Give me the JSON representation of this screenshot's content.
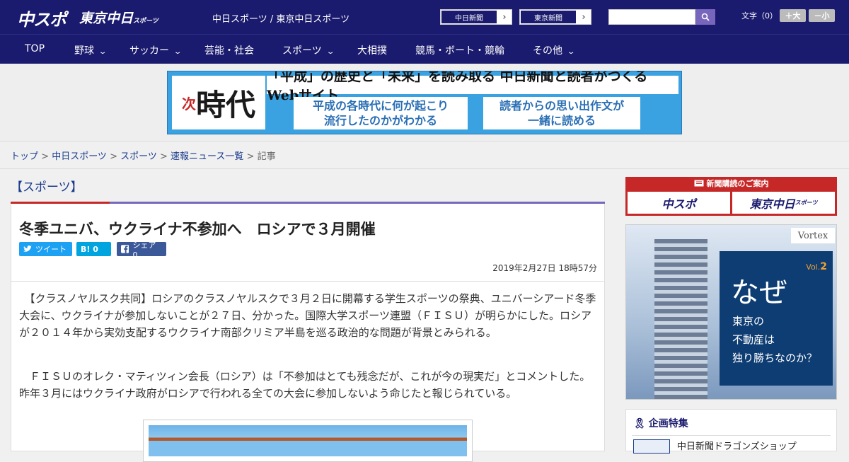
{
  "header": {
    "logo1": "中スポ",
    "logo2": "東京中日",
    "logo2_sub": "スポーツ",
    "site_name": "中日スポーツ / 東京中日スポーツ",
    "ext_links": [
      {
        "label": "中日新聞"
      },
      {
        "label": "東京新聞"
      }
    ],
    "font_size_label": "文字（0）",
    "font_plus": "＋大",
    "font_minus": "－小"
  },
  "nav": {
    "items": [
      {
        "label": "TOP",
        "dropdown": false
      },
      {
        "label": "野球",
        "dropdown": true
      },
      {
        "label": "サッカー",
        "dropdown": true
      },
      {
        "label": "芸能・社会",
        "dropdown": false
      },
      {
        "label": "スポーツ",
        "dropdown": true
      },
      {
        "label": "大相撲",
        "dropdown": false
      },
      {
        "label": "競馬・ボート・競輪",
        "dropdown": false
      },
      {
        "label": "その他",
        "dropdown": true
      }
    ]
  },
  "banner": {
    "kanji_main": "時代",
    "kanji_sub": "次",
    "headline": "「平成」の歴史と「未来」を読み取る 中日新聞と読者がつくるWebサイト",
    "box1_l1": "平成の各時代に何が起こり",
    "box1_l2": "流行したのかがわかる",
    "box2_l1": "読者からの思い出作文が",
    "box2_l2": "一緒に読める"
  },
  "breadcrumb": {
    "items": [
      "トップ",
      "中日スポーツ",
      "スポーツ",
      "速報ニュース一覧"
    ],
    "current": "記事"
  },
  "article": {
    "category": "【スポーツ】",
    "title": "冬季ユニバ、ウクライナ不参加へ　ロシアで３月開催",
    "tweet": "ツイート",
    "hatena": "B! 0",
    "share": "シェア 0",
    "date": "2019年2月27日 18時57分",
    "p1": "　【クラスノヤルスク共同】ロシアのクラスノヤルスクで３月２日に開幕する学生スポーツの祭典、ユニバーシアード冬季大会に、ウクライナが参加しないことが２７日、分かった。国際大学スポーツ連盟（ＦＩＳＵ）が明らかにした。ロシアが２０１４年から実効支配するウクライナ南部クリミア半島を巡る政治的な問題が背景とみられる。",
    "p2": "　ＦＩＳＵのオレク・マティツィン会長（ロシア）は「不参加はとても残念だが、これが今の現実だ」とコメントした。昨年３月にはウクライナ政府がロシアで行われる全ての大会に参加しないよう命じたと報じられている。"
  },
  "sidebar": {
    "subscribe_title": "新聞購読のご案内",
    "sub_logo1": "中スポ",
    "sub_logo2": "東京中日",
    "sub_logo2_small": "スポーツ",
    "ad_brand": "Vortex",
    "ad_vol_prefix": "Vol.",
    "ad_vol_num": "2",
    "ad_big": "なぜ",
    "ad_line1": "東京の",
    "ad_line2": "不動産は",
    "ad_line3": "独り勝ちなのか？",
    "feature_title": "企画特集",
    "feature_item": "中日新聞ドラゴンズショップ"
  }
}
